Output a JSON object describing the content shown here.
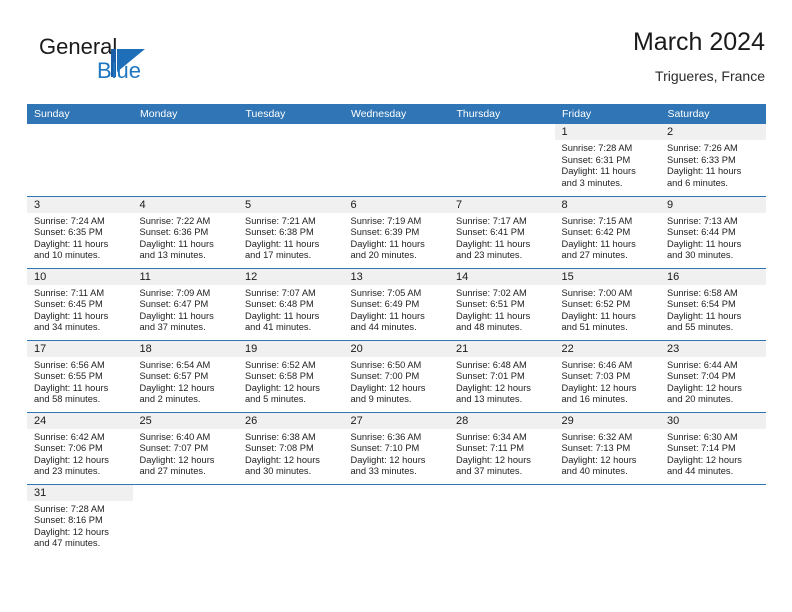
{
  "brand": {
    "word1": "General",
    "word2": "Blue",
    "mark": "triangle-logo",
    "accent_color": "#1f77c2"
  },
  "header": {
    "title": "March 2024",
    "subtitle": "Trigueres, France"
  },
  "theme": {
    "header_blue": "#3075B5",
    "daynum_strip": "#f0f0f0",
    "text": "#222222"
  },
  "calendar": {
    "weekdays": [
      "Sunday",
      "Monday",
      "Tuesday",
      "Wednesday",
      "Thursday",
      "Friday",
      "Saturday"
    ],
    "labels": {
      "sunrise": "Sunrise:",
      "sunset": "Sunset:",
      "daylight": "Daylight:"
    },
    "weeks": [
      [
        {
          "day": ""
        },
        {
          "day": ""
        },
        {
          "day": ""
        },
        {
          "day": ""
        },
        {
          "day": ""
        },
        {
          "day": "1",
          "sunrise": "Sunrise: 7:28 AM",
          "sunset": "Sunset: 6:31 PM",
          "daylight1": "Daylight: 11 hours",
          "daylight2": "and 3 minutes."
        },
        {
          "day": "2",
          "sunrise": "Sunrise: 7:26 AM",
          "sunset": "Sunset: 6:33 PM",
          "daylight1": "Daylight: 11 hours",
          "daylight2": "and 6 minutes."
        }
      ],
      [
        {
          "day": "3",
          "sunrise": "Sunrise: 7:24 AM",
          "sunset": "Sunset: 6:35 PM",
          "daylight1": "Daylight: 11 hours",
          "daylight2": "and 10 minutes."
        },
        {
          "day": "4",
          "sunrise": "Sunrise: 7:22 AM",
          "sunset": "Sunset: 6:36 PM",
          "daylight1": "Daylight: 11 hours",
          "daylight2": "and 13 minutes."
        },
        {
          "day": "5",
          "sunrise": "Sunrise: 7:21 AM",
          "sunset": "Sunset: 6:38 PM",
          "daylight1": "Daylight: 11 hours",
          "daylight2": "and 17 minutes."
        },
        {
          "day": "6",
          "sunrise": "Sunrise: 7:19 AM",
          "sunset": "Sunset: 6:39 PM",
          "daylight1": "Daylight: 11 hours",
          "daylight2": "and 20 minutes."
        },
        {
          "day": "7",
          "sunrise": "Sunrise: 7:17 AM",
          "sunset": "Sunset: 6:41 PM",
          "daylight1": "Daylight: 11 hours",
          "daylight2": "and 23 minutes."
        },
        {
          "day": "8",
          "sunrise": "Sunrise: 7:15 AM",
          "sunset": "Sunset: 6:42 PM",
          "daylight1": "Daylight: 11 hours",
          "daylight2": "and 27 minutes."
        },
        {
          "day": "9",
          "sunrise": "Sunrise: 7:13 AM",
          "sunset": "Sunset: 6:44 PM",
          "daylight1": "Daylight: 11 hours",
          "daylight2": "and 30 minutes."
        }
      ],
      [
        {
          "day": "10",
          "sunrise": "Sunrise: 7:11 AM",
          "sunset": "Sunset: 6:45 PM",
          "daylight1": "Daylight: 11 hours",
          "daylight2": "and 34 minutes."
        },
        {
          "day": "11",
          "sunrise": "Sunrise: 7:09 AM",
          "sunset": "Sunset: 6:47 PM",
          "daylight1": "Daylight: 11 hours",
          "daylight2": "and 37 minutes."
        },
        {
          "day": "12",
          "sunrise": "Sunrise: 7:07 AM",
          "sunset": "Sunset: 6:48 PM",
          "daylight1": "Daylight: 11 hours",
          "daylight2": "and 41 minutes."
        },
        {
          "day": "13",
          "sunrise": "Sunrise: 7:05 AM",
          "sunset": "Sunset: 6:49 PM",
          "daylight1": "Daylight: 11 hours",
          "daylight2": "and 44 minutes."
        },
        {
          "day": "14",
          "sunrise": "Sunrise: 7:02 AM",
          "sunset": "Sunset: 6:51 PM",
          "daylight1": "Daylight: 11 hours",
          "daylight2": "and 48 minutes."
        },
        {
          "day": "15",
          "sunrise": "Sunrise: 7:00 AM",
          "sunset": "Sunset: 6:52 PM",
          "daylight1": "Daylight: 11 hours",
          "daylight2": "and 51 minutes."
        },
        {
          "day": "16",
          "sunrise": "Sunrise: 6:58 AM",
          "sunset": "Sunset: 6:54 PM",
          "daylight1": "Daylight: 11 hours",
          "daylight2": "and 55 minutes."
        }
      ],
      [
        {
          "day": "17",
          "sunrise": "Sunrise: 6:56 AM",
          "sunset": "Sunset: 6:55 PM",
          "daylight1": "Daylight: 11 hours",
          "daylight2": "and 58 minutes."
        },
        {
          "day": "18",
          "sunrise": "Sunrise: 6:54 AM",
          "sunset": "Sunset: 6:57 PM",
          "daylight1": "Daylight: 12 hours",
          "daylight2": "and 2 minutes."
        },
        {
          "day": "19",
          "sunrise": "Sunrise: 6:52 AM",
          "sunset": "Sunset: 6:58 PM",
          "daylight1": "Daylight: 12 hours",
          "daylight2": "and 5 minutes."
        },
        {
          "day": "20",
          "sunrise": "Sunrise: 6:50 AM",
          "sunset": "Sunset: 7:00 PM",
          "daylight1": "Daylight: 12 hours",
          "daylight2": "and 9 minutes."
        },
        {
          "day": "21",
          "sunrise": "Sunrise: 6:48 AM",
          "sunset": "Sunset: 7:01 PM",
          "daylight1": "Daylight: 12 hours",
          "daylight2": "and 13 minutes."
        },
        {
          "day": "22",
          "sunrise": "Sunrise: 6:46 AM",
          "sunset": "Sunset: 7:03 PM",
          "daylight1": "Daylight: 12 hours",
          "daylight2": "and 16 minutes."
        },
        {
          "day": "23",
          "sunrise": "Sunrise: 6:44 AM",
          "sunset": "Sunset: 7:04 PM",
          "daylight1": "Daylight: 12 hours",
          "daylight2": "and 20 minutes."
        }
      ],
      [
        {
          "day": "24",
          "sunrise": "Sunrise: 6:42 AM",
          "sunset": "Sunset: 7:06 PM",
          "daylight1": "Daylight: 12 hours",
          "daylight2": "and 23 minutes."
        },
        {
          "day": "25",
          "sunrise": "Sunrise: 6:40 AM",
          "sunset": "Sunset: 7:07 PM",
          "daylight1": "Daylight: 12 hours",
          "daylight2": "and 27 minutes."
        },
        {
          "day": "26",
          "sunrise": "Sunrise: 6:38 AM",
          "sunset": "Sunset: 7:08 PM",
          "daylight1": "Daylight: 12 hours",
          "daylight2": "and 30 minutes."
        },
        {
          "day": "27",
          "sunrise": "Sunrise: 6:36 AM",
          "sunset": "Sunset: 7:10 PM",
          "daylight1": "Daylight: 12 hours",
          "daylight2": "and 33 minutes."
        },
        {
          "day": "28",
          "sunrise": "Sunrise: 6:34 AM",
          "sunset": "Sunset: 7:11 PM",
          "daylight1": "Daylight: 12 hours",
          "daylight2": "and 37 minutes."
        },
        {
          "day": "29",
          "sunrise": "Sunrise: 6:32 AM",
          "sunset": "Sunset: 7:13 PM",
          "daylight1": "Daylight: 12 hours",
          "daylight2": "and 40 minutes."
        },
        {
          "day": "30",
          "sunrise": "Sunrise: 6:30 AM",
          "sunset": "Sunset: 7:14 PM",
          "daylight1": "Daylight: 12 hours",
          "daylight2": "and 44 minutes."
        }
      ],
      [
        {
          "day": "31",
          "sunrise": "Sunrise: 7:28 AM",
          "sunset": "Sunset: 8:16 PM",
          "daylight1": "Daylight: 12 hours",
          "daylight2": "and 47 minutes."
        },
        {
          "day": ""
        },
        {
          "day": ""
        },
        {
          "day": ""
        },
        {
          "day": ""
        },
        {
          "day": ""
        },
        {
          "day": ""
        }
      ]
    ]
  }
}
